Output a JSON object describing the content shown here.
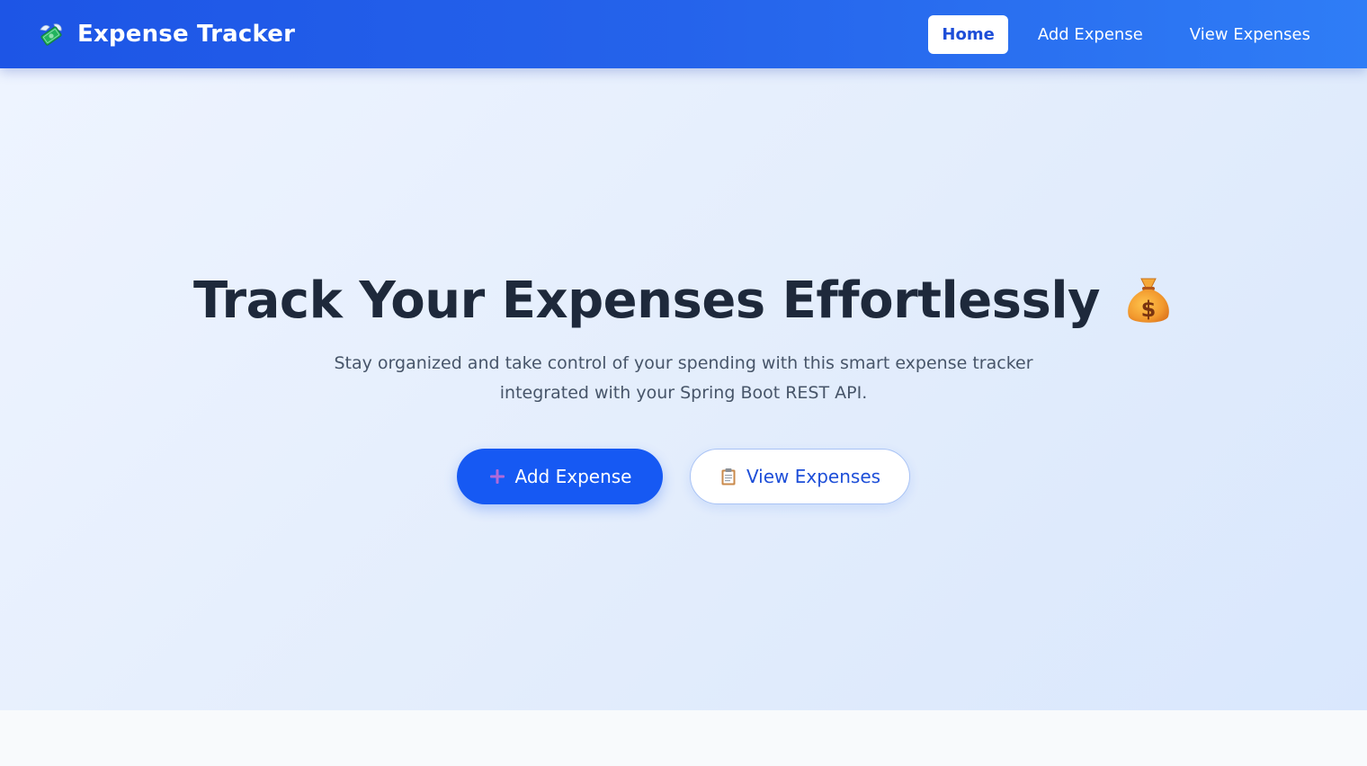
{
  "navbar": {
    "brand_icon": "money-with-wings-icon",
    "brand_title": "Expense Tracker",
    "links": [
      {
        "label": "Home",
        "active": true
      },
      {
        "label": "Add Expense",
        "active": false
      },
      {
        "label": "View Expenses",
        "active": false
      }
    ]
  },
  "hero": {
    "title": "Track Your Expenses Effortlessly",
    "title_icon": "money-bag-icon",
    "subtitle_line1": "Stay organized and take control of your spending with this smart expense tracker",
    "subtitle_line2": "integrated with your Spring Boot REST API.",
    "primary_button": {
      "label": "Add Expense",
      "icon": "plus-icon"
    },
    "secondary_button": {
      "label": "View Expenses",
      "icon": "clipboard-icon"
    }
  },
  "colors": {
    "nav_gradient_start": "#1d55e6",
    "nav_gradient_end": "#2f7df6",
    "primary": "#1659f3",
    "title_text": "#1e293b",
    "subtitle_text": "#475569",
    "hero_bg": "#e3edfc"
  }
}
